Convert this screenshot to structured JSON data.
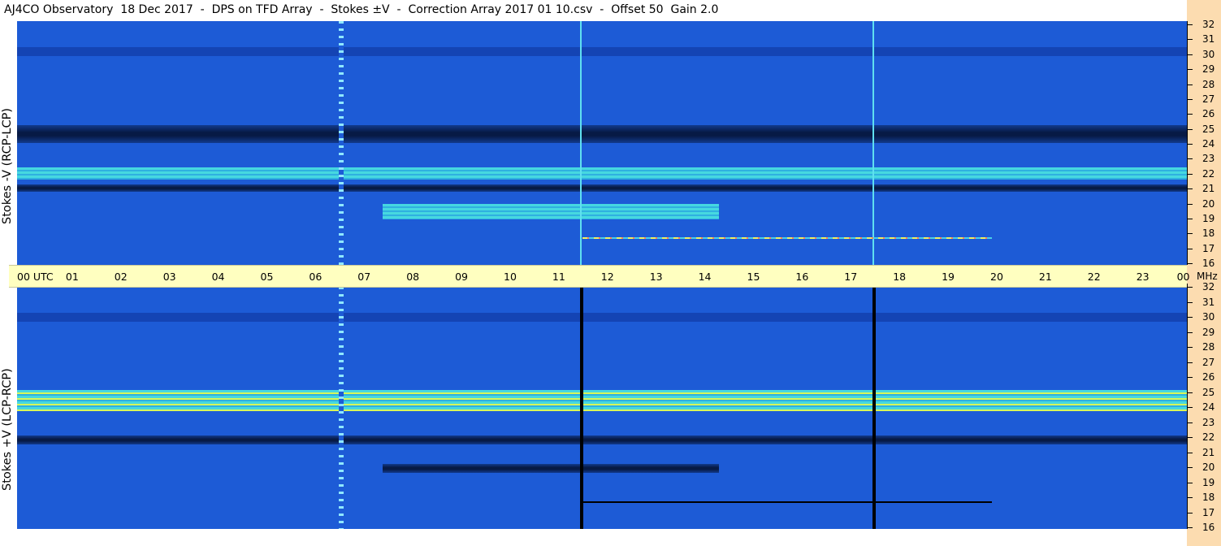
{
  "title": "AJ4CO Observatory  18 Dec 2017  -  DPS on TFD Array  -  Stokes ±V  -  Correction Array 2017 01 10.csv  -  Offset 50  Gain 2.0",
  "panels": [
    {
      "id": "top",
      "ylabel": "Stokes -V (RCP-LCP)"
    },
    {
      "id": "bottom",
      "ylabel": "Stokes +V (LCP-RCP)"
    }
  ],
  "time_axis": {
    "labels": [
      "00 UTC",
      "01",
      "02",
      "03",
      "04",
      "05",
      "06",
      "07",
      "08",
      "09",
      "10",
      "11",
      "12",
      "13",
      "14",
      "15",
      "16",
      "17",
      "18",
      "19",
      "20",
      "21",
      "22",
      "23",
      "00"
    ],
    "unit_label": "MHz"
  },
  "freq_axis": {
    "labels": [
      "32",
      "31",
      "30",
      "29",
      "28",
      "27",
      "26",
      "25",
      "24",
      "23",
      "22",
      "21",
      "20",
      "19",
      "18",
      "17",
      "16"
    ]
  },
  "colors": {
    "background_blue": "#1d5bd6",
    "dark_band": "#071a45",
    "bright_band": "#46d8e0",
    "yellow_highlight": "#d7f65a",
    "time_axis_bg": "#ffffc0",
    "right_strip_bg": "#fcdcb0"
  },
  "chart_data": [
    {
      "type": "heatmap",
      "title": "AJ4CO Observatory  18 Dec 2017  -  DPS on TFD Array  -  Stokes ±V  -  Correction Array 2017 01 10.csv  -  Offset 50  Gain 2.0",
      "panel": "Stokes -V (RCP-LCP)",
      "xlabel": "UTC",
      "ylabel": "MHz",
      "xlim": [
        0,
        24
      ],
      "ylim": [
        16,
        32
      ],
      "features": [
        {
          "kind": "dark_band",
          "freq_mhz": [
            24.0,
            25.2
          ],
          "time_utc": [
            0,
            24
          ]
        },
        {
          "kind": "bright_band",
          "freq_mhz": [
            21.6,
            22.4
          ],
          "time_utc": [
            0,
            24
          ]
        },
        {
          "kind": "dark_band",
          "freq_mhz": [
            20.8,
            21.3
          ],
          "time_utc": [
            0,
            24
          ]
        },
        {
          "kind": "bright_band",
          "freq_mhz": [
            19.0,
            20.0
          ],
          "time_utc": [
            7.5,
            14.4
          ]
        },
        {
          "kind": "vertical_line",
          "time_utc": 11.55
        },
        {
          "kind": "vertical_line",
          "time_utc": 17.55
        },
        {
          "kind": "dotted_column",
          "time_utc": 6.6
        }
      ]
    },
    {
      "type": "heatmap",
      "panel": "Stokes +V (LCP-RCP)",
      "xlabel": "UTC",
      "ylabel": "MHz",
      "xlim": [
        0,
        24
      ],
      "ylim": [
        16,
        32
      ],
      "features": [
        {
          "kind": "bright_band",
          "freq_mhz": [
            23.8,
            25.2
          ],
          "time_utc": [
            0,
            24
          ]
        },
        {
          "kind": "dark_band",
          "freq_mhz": [
            21.6,
            22.2
          ],
          "time_utc": [
            0,
            24
          ]
        },
        {
          "kind": "dark_band",
          "freq_mhz": [
            19.7,
            20.3
          ],
          "time_utc": [
            7.5,
            14.4
          ]
        },
        {
          "kind": "vertical_line",
          "time_utc": 11.55
        },
        {
          "kind": "vertical_line",
          "time_utc": 17.55
        },
        {
          "kind": "dotted_column",
          "time_utc": 6.6
        }
      ]
    }
  ]
}
